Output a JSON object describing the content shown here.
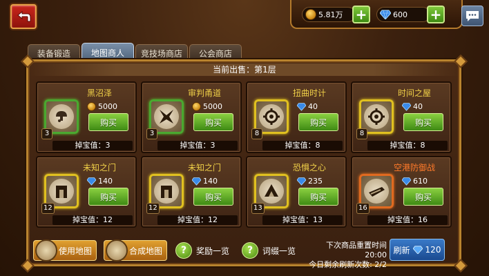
{
  "header": {
    "gold_amount": "5.81万",
    "gem_amount": "600",
    "plus_label": "+"
  },
  "tabs": [
    {
      "label": "装备锻造"
    },
    {
      "label": "地图商人"
    },
    {
      "label": "竞技场商店"
    },
    {
      "label": "公会商店"
    }
  ],
  "active_tab": "地图商人",
  "subtitle": "当前出售：第1层",
  "cards": [
    {
      "name": "黑沼泽",
      "price": "5000",
      "currency": "gold",
      "level": "3",
      "drop": "掉宝值：3",
      "rarity": "green",
      "buy": "购买"
    },
    {
      "name": "审判甬道",
      "price": "5000",
      "currency": "gold",
      "level": "3",
      "drop": "掉宝值：3",
      "rarity": "green",
      "buy": "购买"
    },
    {
      "name": "扭曲时计",
      "price": "40",
      "currency": "gem",
      "level": "8",
      "drop": "掉宝值：8",
      "rarity": "yellow",
      "buy": "购买"
    },
    {
      "name": "时间之屋",
      "price": "40",
      "currency": "gem",
      "level": "8",
      "drop": "掉宝值：8",
      "rarity": "yellow",
      "buy": "购买"
    },
    {
      "name": "未知之门",
      "price": "140",
      "currency": "gem",
      "level": "12",
      "drop": "掉宝值：12",
      "rarity": "yellow",
      "buy": "购买"
    },
    {
      "name": "未知之门",
      "price": "140",
      "currency": "gem",
      "level": "12",
      "drop": "掉宝值：12",
      "rarity": "yellow",
      "buy": "购买"
    },
    {
      "name": "恐惧之心",
      "price": "235",
      "currency": "gem",
      "level": "13",
      "drop": "掉宝值：13",
      "rarity": "yellow",
      "buy": "购买"
    },
    {
      "name": "空港防御战",
      "price": "610",
      "currency": "gem",
      "level": "16",
      "drop": "掉宝值：16",
      "rarity": "orange",
      "buy": "购买"
    }
  ],
  "bottom": {
    "use_map": "使用地图",
    "combine_map": "合成地图",
    "reward_list": "奖励一览",
    "affix_list": "词缀一览",
    "reset_time": "下次商品重置时间 20:00",
    "refresh_remaining": "今日剩余刷新次数: 2/2",
    "refresh_label": "刷新",
    "refresh_cost": "120"
  },
  "colors": {
    "accent_gold": "#f0d048",
    "buy_green": "#5ca820",
    "refresh_blue": "#2a64b0"
  }
}
